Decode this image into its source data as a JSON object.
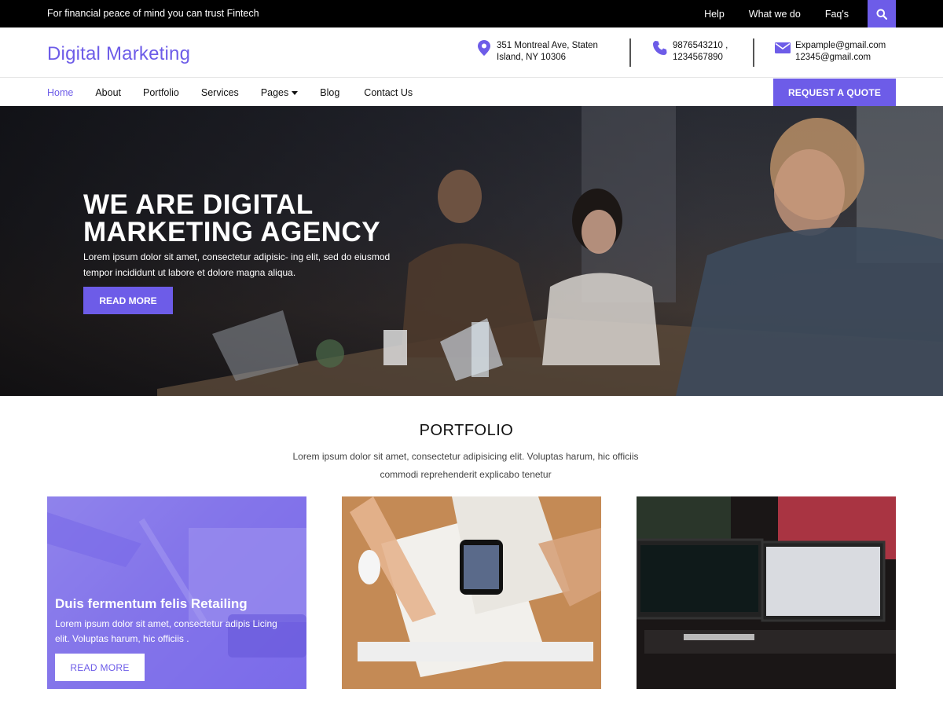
{
  "colors": {
    "accent": "#6d5ce8",
    "topbar_bg": "#000000"
  },
  "topbar": {
    "tagline": "For financial peace of mind you can trust Fintech",
    "links": [
      "Help",
      "What we do",
      "Faq's"
    ],
    "search_icon": "search-icon"
  },
  "header": {
    "logo": "Digital Marketing",
    "address": {
      "icon": "map-pin-icon",
      "line1": "351 Montreal Ave, Staten",
      "line2": "Island, NY 10306"
    },
    "phone": {
      "icon": "phone-icon",
      "line1": "9876543210 ,",
      "line2": "1234567890"
    },
    "email": {
      "icon": "envelope-icon",
      "line1": "Expample@gmail.com",
      "line2": "12345@gmail.com"
    }
  },
  "nav": {
    "items": [
      "Home",
      "About",
      "Portfolio",
      "Services",
      "Pages",
      "Blog",
      "Contact Us"
    ],
    "active": "Home",
    "quote_button": "REQUEST A QUOTE"
  },
  "hero": {
    "title_line1": "WE ARE DIGITAL",
    "title_line2": "MARKETING AGENCY",
    "text": "Lorem ipsum dolor sit amet, consectetur adipisic- ing elit, sed  do eiusmod tempor incididunt ut labore et dolore magna aliqua.",
    "button": "READ MORE"
  },
  "portfolio": {
    "title": "PORTFOLIO",
    "description": "Lorem ipsum dolor sit amet, consectetur adipisicing elit. Voluptas harum, hic officiis commodi reprehenderit explicabo tenetur",
    "cards": [
      {
        "title": "Duis fermentum felis Retailing",
        "text": "Lorem ipsum dolor sit amet, consectetur adipis Licing elit. Voluptas harum, hic officiis .",
        "button": "READ MORE"
      },
      {},
      {}
    ]
  }
}
